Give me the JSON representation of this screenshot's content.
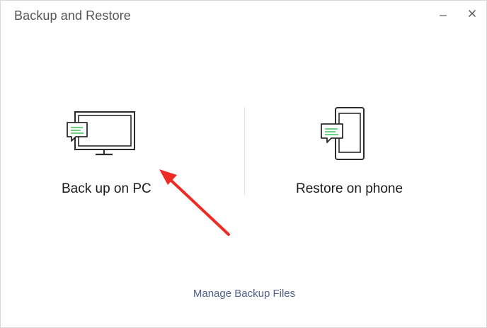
{
  "window": {
    "title": "Backup and Restore",
    "controls": {
      "minimize": "minimize-icon",
      "close": "close-icon"
    }
  },
  "options": {
    "backup_pc": {
      "label": "Back up on PC",
      "icon": "monitor-chat-icon"
    },
    "restore_phone": {
      "label": "Restore on phone",
      "icon": "phone-chat-icon"
    }
  },
  "footer": {
    "manage_link": "Manage Backup Files"
  },
  "colors": {
    "accent_green": "#3fc15a",
    "link": "#4d5f8a",
    "annotation_arrow": "#ee2a24",
    "icon_stroke": "#2b2b2b"
  }
}
